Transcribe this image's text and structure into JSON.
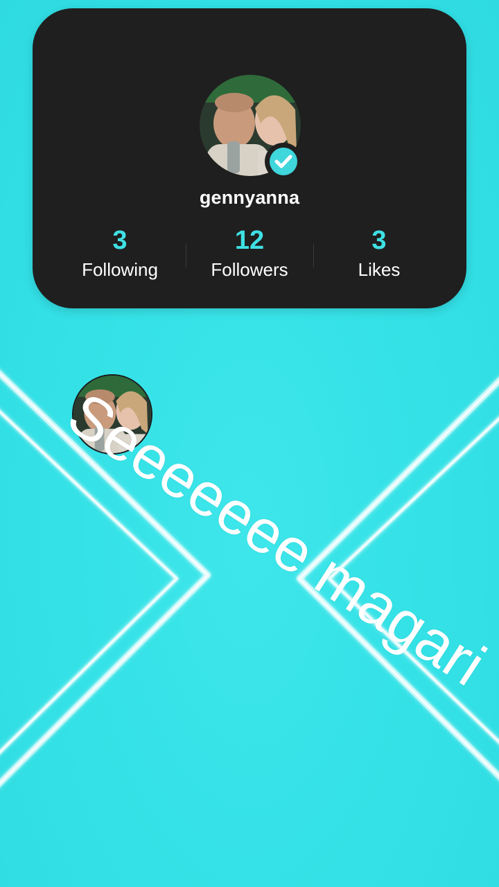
{
  "profile": {
    "username": "gennyanna",
    "verified": true,
    "stats": [
      {
        "value": "3",
        "label": "Following"
      },
      {
        "value": "12",
        "label": "Followers"
      },
      {
        "value": "3",
        "label": "Likes"
      }
    ]
  },
  "caption": "Seeeeeee magari",
  "colors": {
    "background": "#33e1e6",
    "card": "#1f1f1f",
    "accent": "#3fe0e4",
    "text": "#ffffff"
  },
  "icons": {
    "verified": "verified-check-icon",
    "avatar": "avatar"
  }
}
